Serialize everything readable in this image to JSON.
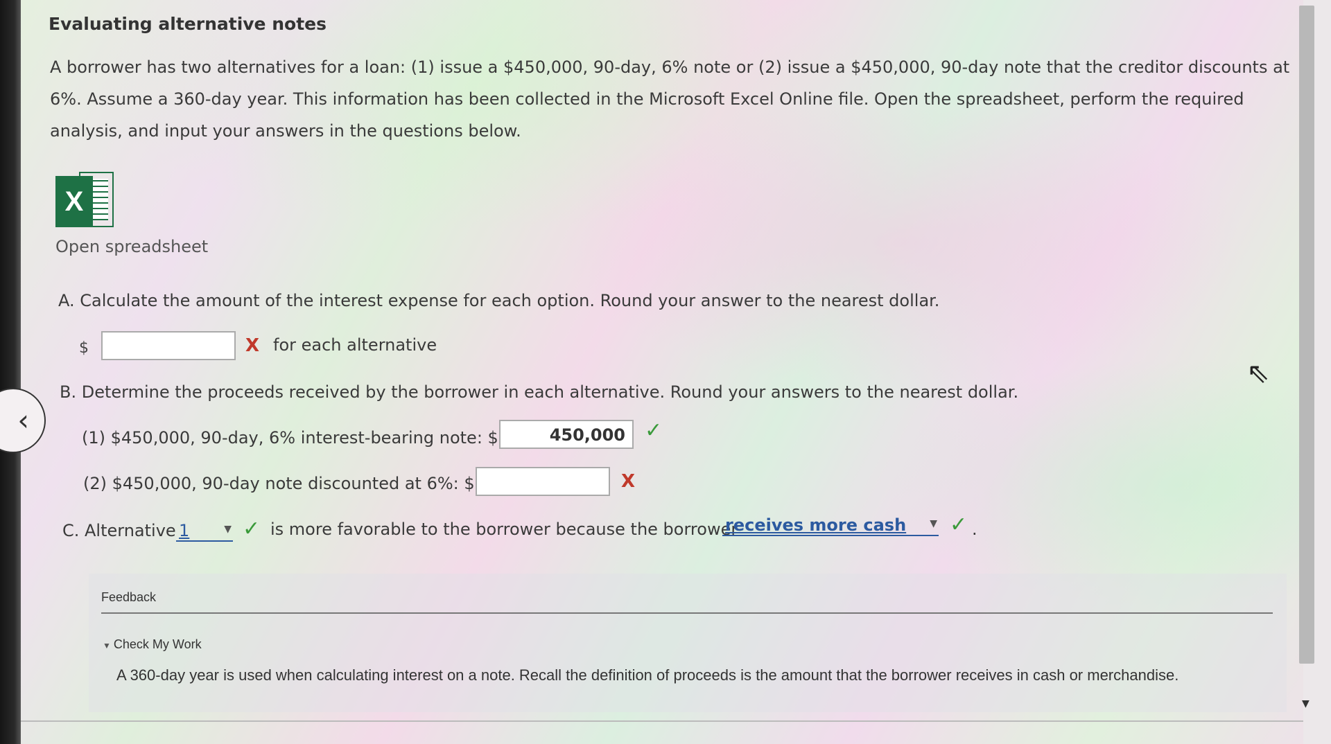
{
  "title": "Evaluating alternative notes",
  "intro": "A borrower has two alternatives for a loan: (1) issue a $450,000, 90-day, 6% note or (2) issue a $450,000, 90-day note that the creditor discounts at 6%. Assume a 360-day year. This information has been collected in the Microsoft Excel Online file. Open the spreadsheet, perform the required analysis, and input your answers in the questions below.",
  "spreadsheet": {
    "link_label": "Open spreadsheet",
    "icon_letter": "X"
  },
  "part_a": {
    "prompt": "A. Calculate the amount of the interest expense for each option. Round your answer to the nearest dollar.",
    "currency": "$",
    "value": "",
    "mark": "X",
    "suffix": "for each alternative"
  },
  "part_b": {
    "prompt": "B. Determine the proceeds received by the borrower in each alternative. Round your answers to the nearest dollar.",
    "item1_label": "(1) $450,000, 90-day, 6% interest-bearing note: $",
    "item1_value": "450,000",
    "item1_mark": "✓",
    "item2_label": "(2) $450,000, 90-day note discounted at 6%: $",
    "item2_value": "",
    "item2_mark": "X"
  },
  "part_c": {
    "prefix": "C. Alternative",
    "alternative_selected": "1",
    "middle": "is more favorable to the borrower because the borrower",
    "reason_selected": "receives more cash",
    "mark": "✓",
    "end": "."
  },
  "feedback": {
    "label": "Feedback",
    "toggle_label": "Check My Work",
    "text": "A 360-day year is used when calculating interest on a note. Recall the definition of proceeds is the amount that the borrower receives in cash or merchandise."
  },
  "colors": {
    "correct": "#3a9a3a",
    "incorrect": "#c0392b",
    "excel_green": "#1e7145",
    "link_blue": "#2c5aa0"
  }
}
